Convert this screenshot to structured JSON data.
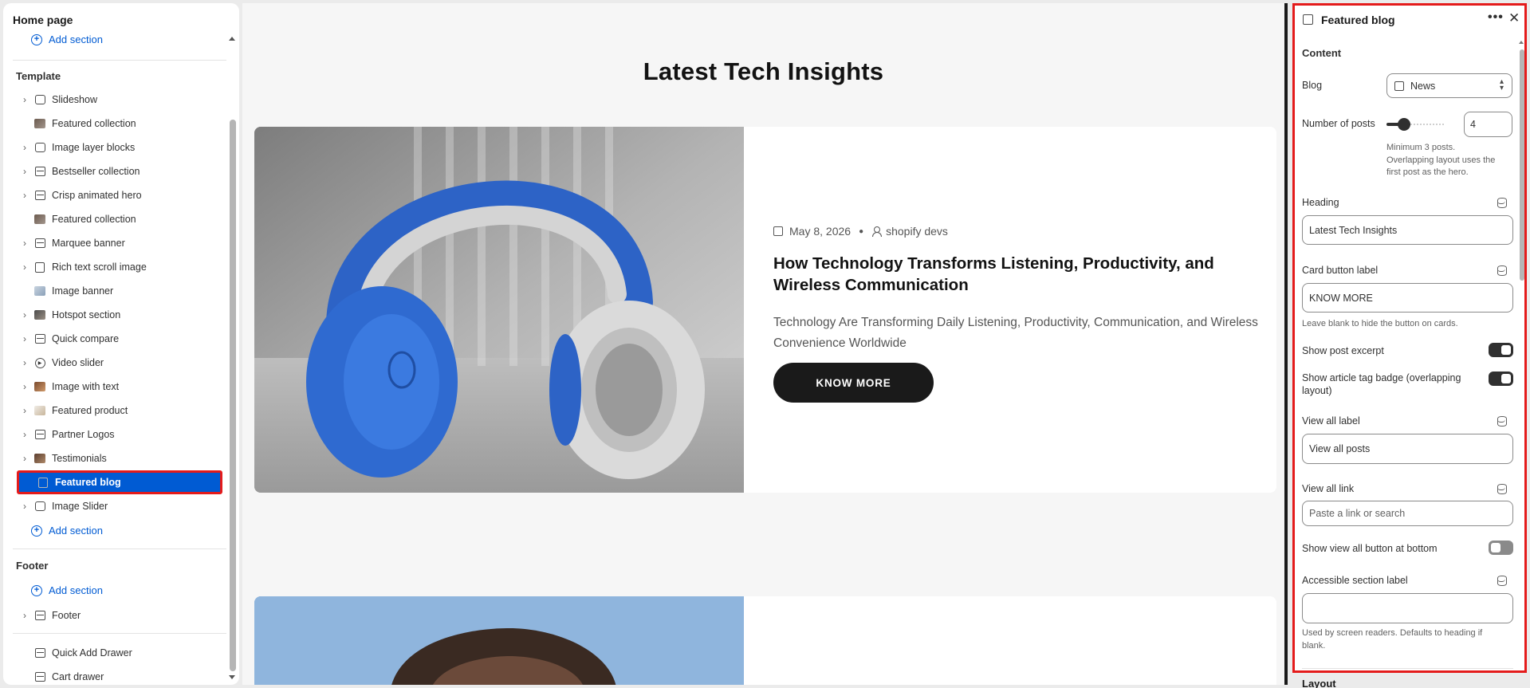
{
  "sidebar": {
    "title": "Home page",
    "add_section_top": "Add section",
    "template_heading": "Template",
    "items": [
      {
        "label": "Slideshow",
        "icon": "slideshow-icon",
        "chevron": true
      },
      {
        "label": "Featured collection",
        "icon": "collection-thumbnail",
        "chevron": false
      },
      {
        "label": "Image layer blocks",
        "icon": "image-icon",
        "chevron": true
      },
      {
        "label": "Bestseller collection",
        "icon": "section-icon",
        "chevron": true
      },
      {
        "label": "Crisp animated hero",
        "icon": "section-icon",
        "chevron": true
      },
      {
        "label": "Featured collection",
        "icon": "collection-thumbnail",
        "chevron": false
      },
      {
        "label": "Marquee banner",
        "icon": "section-icon",
        "chevron": true
      },
      {
        "label": "Rich text scroll image",
        "icon": "text-icon",
        "chevron": true
      },
      {
        "label": "Image banner",
        "icon": "banner-thumbnail",
        "chevron": false
      },
      {
        "label": "Hotspot section",
        "icon": "hotspot-thumbnail",
        "chevron": true
      },
      {
        "label": "Quick compare",
        "icon": "section-icon",
        "chevron": true
      },
      {
        "label": "Video slider",
        "icon": "play-icon",
        "chevron": true
      },
      {
        "label": "Image with text",
        "icon": "image-text-thumbnail",
        "chevron": true
      },
      {
        "label": "Featured product",
        "icon": "product-thumbnail",
        "chevron": true
      },
      {
        "label": "Partner Logos",
        "icon": "section-icon",
        "chevron": true
      },
      {
        "label": "Testimonials",
        "icon": "testimonial-thumbnail",
        "chevron": true
      },
      {
        "label": "Featured blog",
        "icon": "blog-icon",
        "chevron": false,
        "selected": true
      },
      {
        "label": "Image Slider",
        "icon": "image-icon",
        "chevron": true
      }
    ],
    "add_section_template": "Add section",
    "footer_heading": "Footer",
    "add_section_footer": "Add section",
    "footer_item": "Footer",
    "overlays": [
      "Quick Add Drawer",
      "Cart drawer"
    ]
  },
  "preview": {
    "heading": "Latest Tech Insights",
    "post": {
      "date": "May 8, 2026",
      "author": "shopify devs",
      "title": "How Technology Transforms Listening, Productivity, and Wireless Communication",
      "excerpt": "Technology Are Transforming Daily Listening, Productivity, Communication, and Wireless Convenience Worldwide",
      "button": "KNOW MORE"
    }
  },
  "panel": {
    "title": "Featured blog",
    "more": "•••",
    "close": "✕",
    "content_heading": "Content",
    "blog_label": "Blog",
    "blog_value": "News",
    "posts_label": "Number of posts",
    "posts_value": 4,
    "posts_help_1": "Minimum 3 posts.",
    "posts_help_2": "Overlapping layout uses the",
    "posts_help_3": "first post as the hero.",
    "heading_label": "Heading",
    "heading_value": "Latest Tech Insights",
    "card_button_label": "Card button label",
    "card_button_value": "KNOW MORE",
    "card_button_help": "Leave blank to hide the button on cards.",
    "show_excerpt_label": "Show post excerpt",
    "show_excerpt_on": true,
    "show_tag_label_1": "Show article tag badge (overlapping",
    "show_tag_label_2": "layout)",
    "show_tag_on": true,
    "view_all_label": "View all label",
    "view_all_value": "View all posts",
    "view_all_link_label": "View all link",
    "view_all_link_placeholder": "Paste a link or search",
    "show_view_all_bottom_label": "Show view all button at bottom",
    "show_view_all_bottom_on": false,
    "accessible_label": "Accessible section label",
    "accessible_value": "",
    "accessible_help_1": "Used by screen readers. Defaults to heading if",
    "accessible_help_2": "blank.",
    "layout_heading": "Layout"
  },
  "colors": {
    "accent": "#005bd3",
    "highlight": "#e41b1b",
    "button_dark": "#1a1a1a"
  }
}
